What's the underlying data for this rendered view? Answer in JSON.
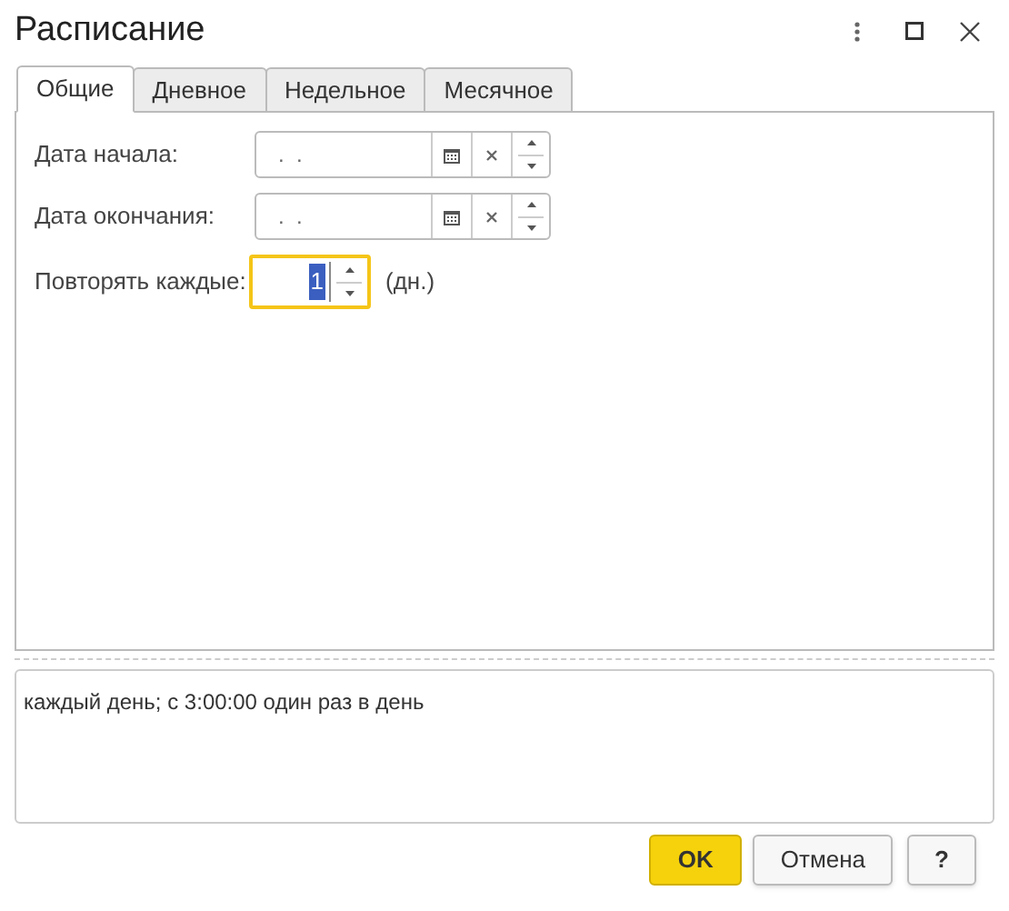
{
  "window": {
    "title": "Расписание"
  },
  "tabs": [
    {
      "label": "Общие",
      "selected": true
    },
    {
      "label": "Дневное",
      "selected": false
    },
    {
      "label": "Недельное",
      "selected": false
    },
    {
      "label": "Месячное",
      "selected": false
    }
  ],
  "fields": [
    {
      "kind": "date",
      "label": "Дата начала:",
      "value": ".  ."
    },
    {
      "kind": "date",
      "label": "Дата окончания:",
      "value": ".  ."
    },
    {
      "kind": "number",
      "label": "Повторять каждые:",
      "value": "1",
      "focused": true,
      "unit": "(дн.)"
    }
  ],
  "description": "каждый день; с 3:00:00 один раз в день",
  "buttons": [
    {
      "label": "OK",
      "kind": "primary"
    },
    {
      "label": "Отмена",
      "kind": "normal"
    },
    {
      "label": "?",
      "kind": "normal"
    }
  ]
}
